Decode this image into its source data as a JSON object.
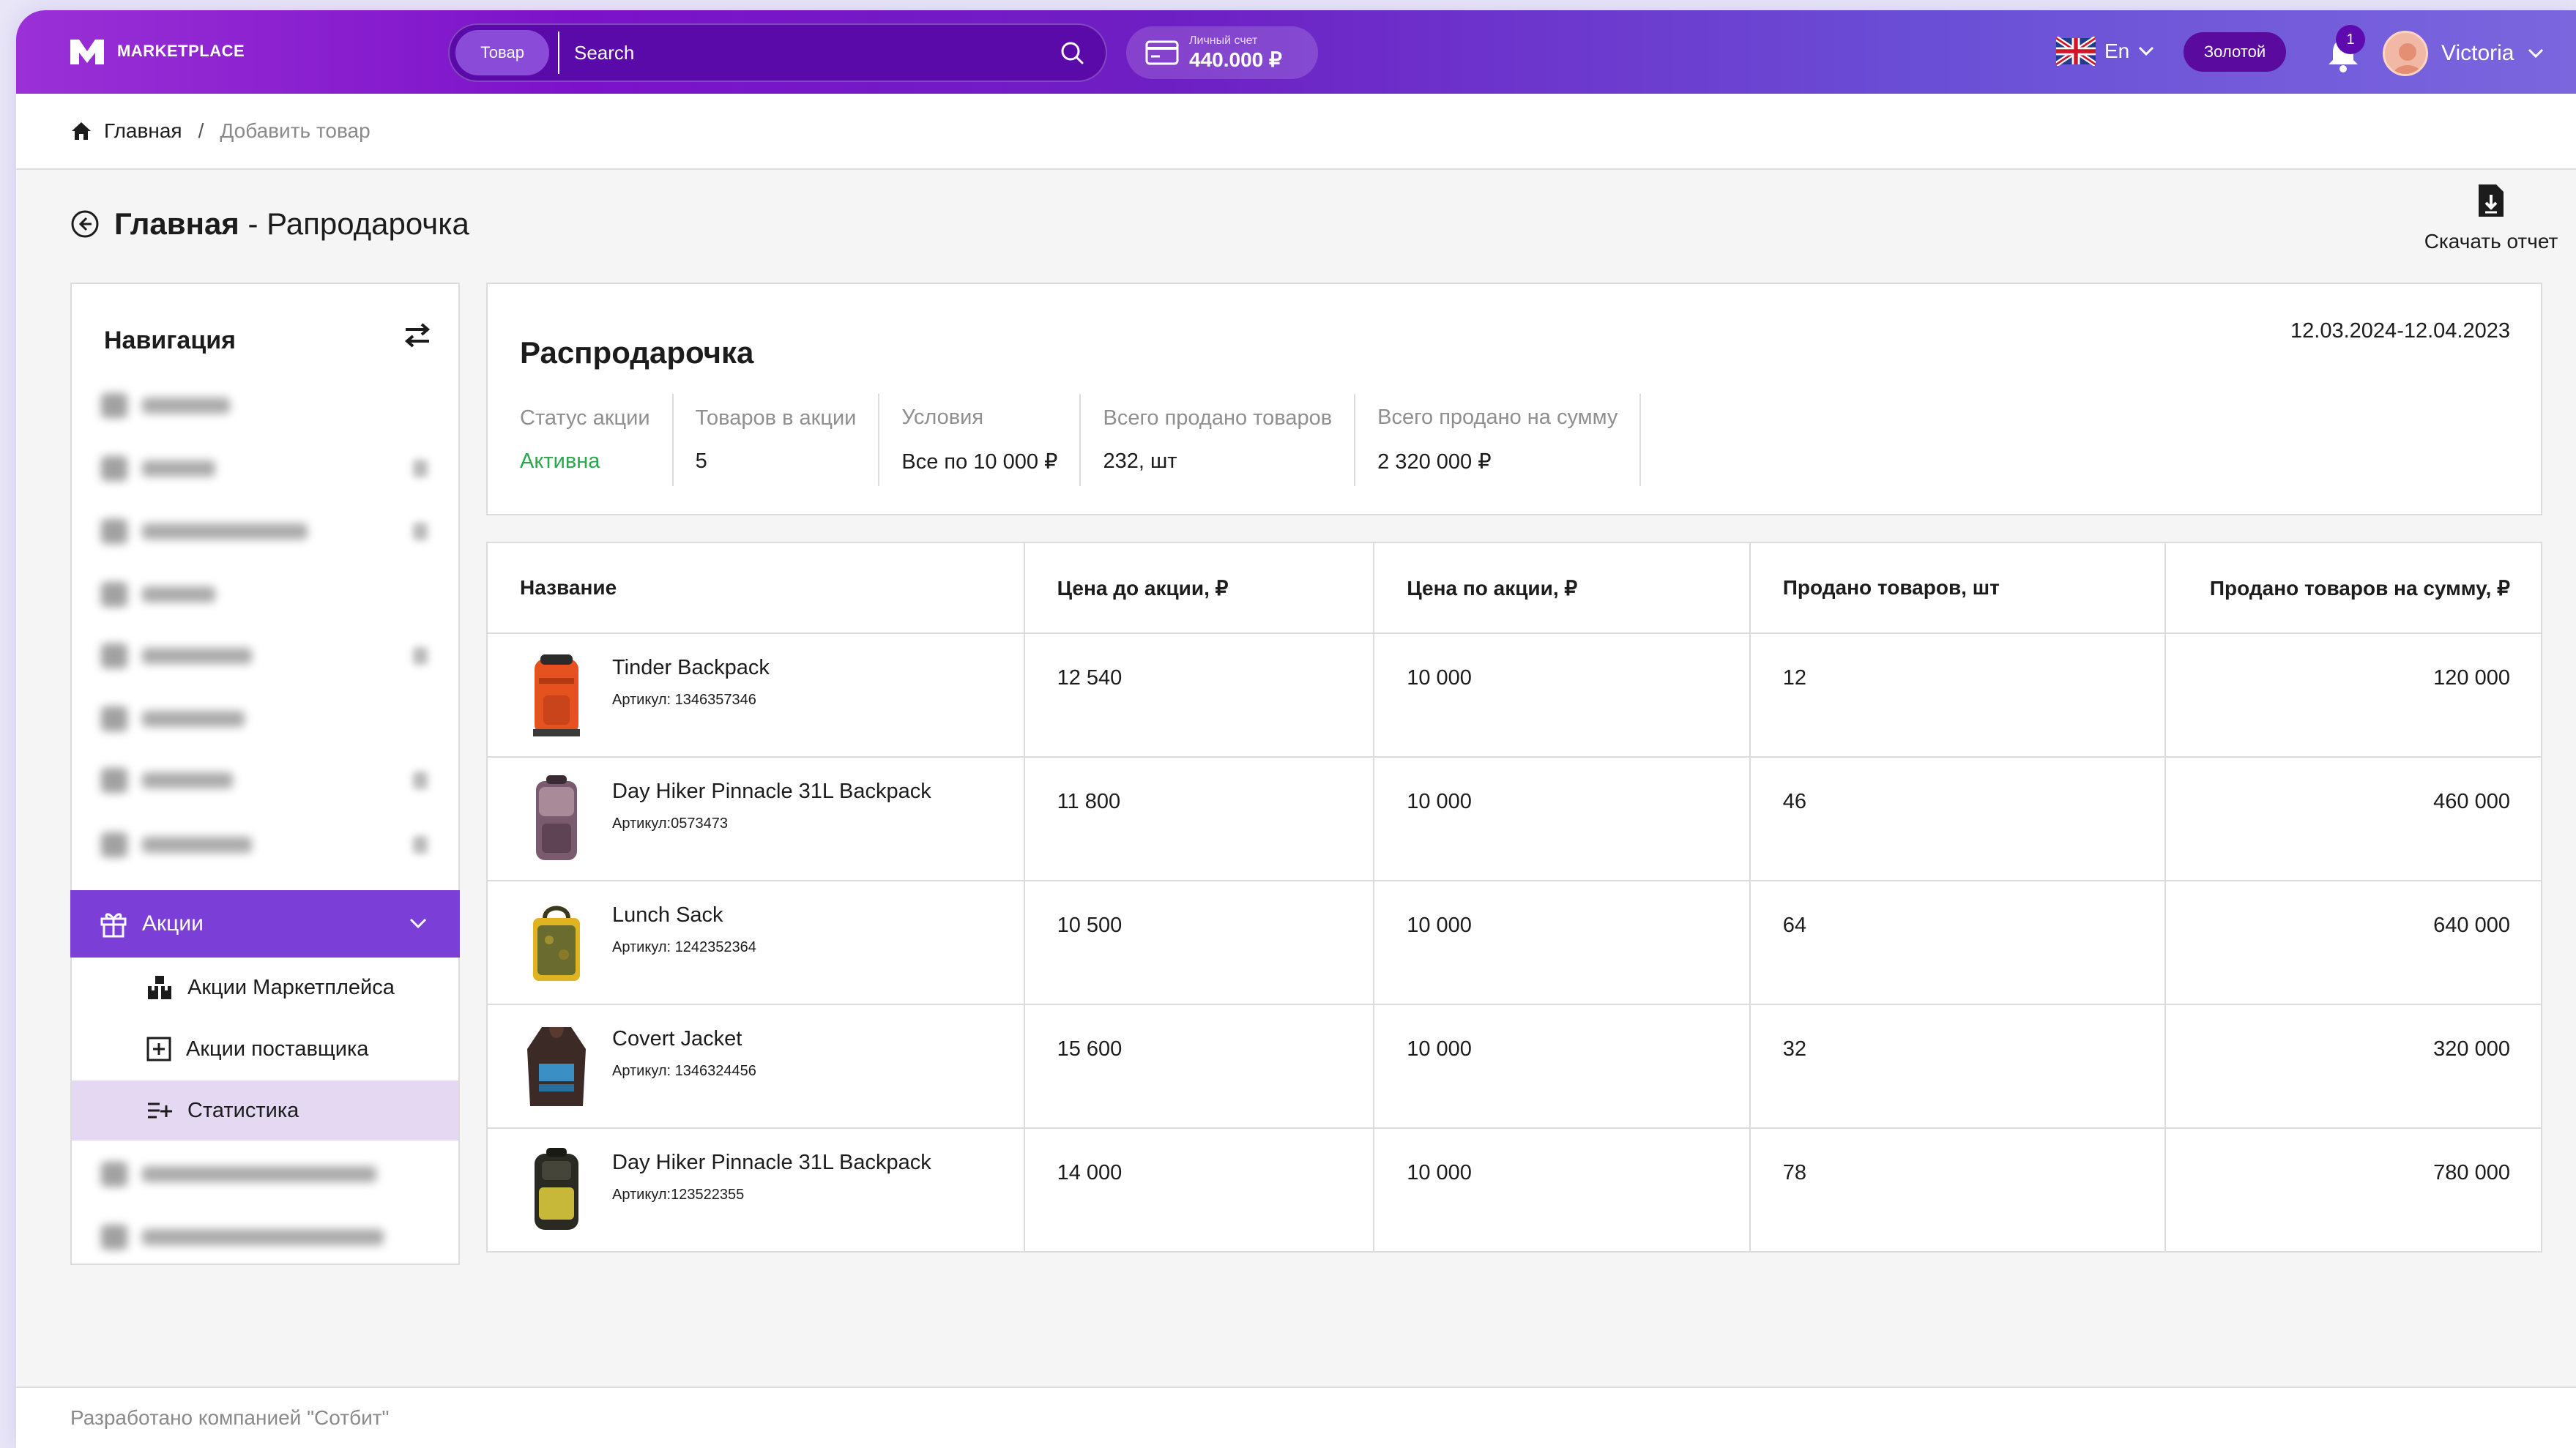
{
  "header": {
    "logo_text": "MARKETPLACE",
    "search_chip": "Товар",
    "search_placeholder": "Search",
    "account_label": "Личный счет",
    "account_value": "440.000 ₽",
    "lang": "En",
    "status_badge": "Золотой",
    "notifications": "1",
    "user_name": "Victoria"
  },
  "breadcrumb": {
    "home": "Главная",
    "separator": "/",
    "current": "Добавить товар"
  },
  "page": {
    "title_bold": "Главная",
    "title_rest": " - Рапродарочка",
    "download_label": "Скачать отчет"
  },
  "sidebar": {
    "heading": "Навигация",
    "active_item": "Акции",
    "sub_items": [
      {
        "label": "Акции Маркетплейса",
        "icon": "boxes-icon"
      },
      {
        "label": "Акции поставщика",
        "icon": "plus-square-icon"
      },
      {
        "label": "Статистика",
        "icon": "list-plus-icon"
      }
    ]
  },
  "summary": {
    "title": "Распродарочка",
    "date_range": "12.03.2024-12.04.2023",
    "stats": [
      {
        "label": "Статус акции",
        "value": "Активна"
      },
      {
        "label": "Товаров в акции",
        "value": "5"
      },
      {
        "label": "Условия",
        "value": "Все по 10 000  ₽"
      },
      {
        "label": "Всего продано товаров",
        "value": "232, шт"
      },
      {
        "label": "Всего продано на сумму",
        "value": "2 320 000  ₽"
      }
    ]
  },
  "table": {
    "headers": [
      "Название",
      "Цена до акции, ₽",
      "Цена по акции, ₽",
      "Продано товаров, шт",
      "Продано товаров на сумму, ₽"
    ],
    "rows": [
      {
        "name": "Tinder Backpack",
        "sku": "Артикул: 1346357346",
        "price_before": "12 540",
        "price_promo": "10 000",
        "sold": "12",
        "sum": "120 000"
      },
      {
        "name": "Day Hiker Pinnacle 31L Backpack",
        "sku": "Артикул:0573473",
        "price_before": "11 800",
        "price_promo": "10 000",
        "sold": "46",
        "sum": "460 000"
      },
      {
        "name": "Lunch Sack",
        "sku": "Артикул: 1242352364",
        "price_before": "10 500",
        "price_promo": "10 000",
        "sold": "64",
        "sum": "640 000"
      },
      {
        "name": "Covert Jacket",
        "sku": "Артикул: 1346324456",
        "price_before": "15 600",
        "price_promo": "10 000",
        "sold": "32",
        "sum": "320 000"
      },
      {
        "name": "Day Hiker Pinnacle 31L Backpack",
        "sku": "Артикул:123522355",
        "price_before": "14 000",
        "price_promo": "10 000",
        "sold": "78",
        "sum": "780 000"
      }
    ]
  },
  "footer": {
    "text": "Разработано компанией \"Сотбит\""
  },
  "colors": {
    "accent": "#7b3ed6",
    "active_status": "#27a84a",
    "selected_bg": "#e4d8f3"
  }
}
